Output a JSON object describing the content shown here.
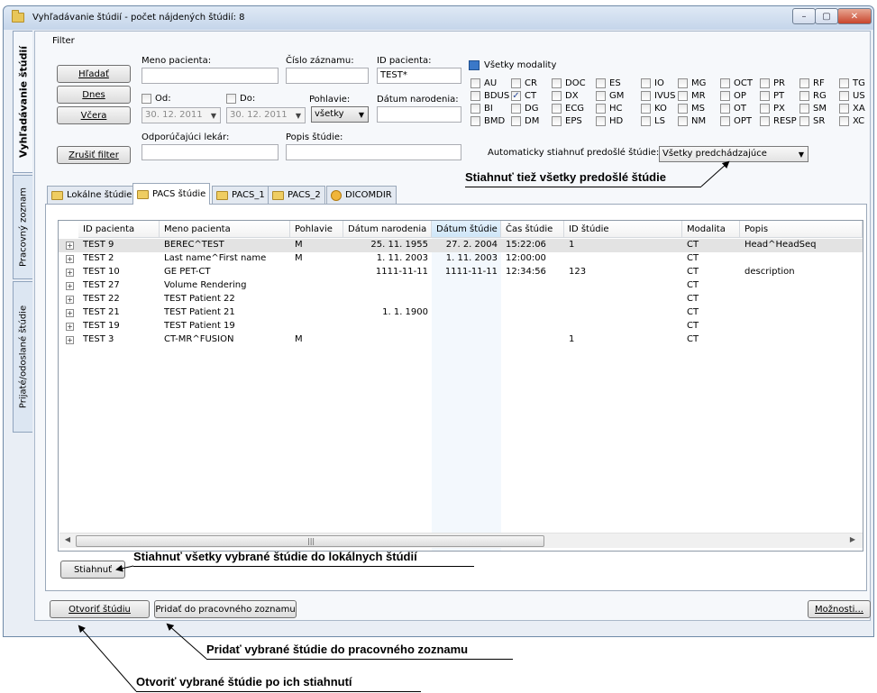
{
  "window": {
    "title": "Vyhľadávanie štúdií - počet nájdených štúdií: 8",
    "minimize": "–",
    "maximize": "▢",
    "close": "✕"
  },
  "side_tabs": [
    "Vyhľadávanie štúdií",
    "Pracovný zoznam",
    "Prijaté/odoslané štúdie"
  ],
  "filter": {
    "group_label": "Filter",
    "btn_search": "Hľadať",
    "btn_today": "Dnes",
    "btn_yesterday": "Včera",
    "btn_clear": "Zrušiť filter",
    "patient_name_label": "Meno pacienta:",
    "patient_name_value": "",
    "record_no_label": "Číslo záznamu:",
    "record_no_value": "",
    "patient_id_label": "ID pacienta:",
    "patient_id_value": "TEST*",
    "from_label": "Od:",
    "from_value": "30. 12. 2011",
    "to_label": "Do:",
    "to_value": "30. 12. 2011",
    "sex_label": "Pohlavie:",
    "sex_value": "všetky",
    "dob_label": "Dátum narodenia:",
    "dob_value": "",
    "referring_label": "Odporúčajúci lekár:",
    "referring_value": "",
    "study_desc_label": "Popis štúdie:",
    "study_desc_value": "",
    "all_modalities_label": "Všetky modality",
    "modalities": [
      [
        "AU",
        "CR",
        "DOC",
        "ES",
        "IO",
        "MG",
        "OCT",
        "PR",
        "RF",
        "TG"
      ],
      [
        "BDUS",
        "CT",
        "DX",
        "GM",
        "IVUS",
        "MR",
        "OP",
        "PT",
        "RG",
        "US"
      ],
      [
        "BI",
        "DG",
        "ECG",
        "HC",
        "KO",
        "MS",
        "OT",
        "PX",
        "SM",
        "XA"
      ],
      [
        "BMD",
        "DM",
        "EPS",
        "HD",
        "LS",
        "NM",
        "OPT",
        "RESP",
        "SR",
        "XC"
      ]
    ],
    "checked_modality": "CT",
    "auto_download_label": "Automaticky stiahnuť predošlé štúdie:",
    "auto_download_value": "Všetky predchádzajúce"
  },
  "tabs": [
    "Lokálne štúdie",
    "PACS štúdie",
    "PACS_1",
    "PACS_2",
    "DICOMDIR"
  ],
  "active_tab": "PACS štúdie",
  "grid": {
    "columns": [
      "ID pacienta",
      "Meno pacienta",
      "Pohlavie",
      "Dátum narodenia",
      "Dátum štúdie",
      "Čas štúdie",
      "ID štúdie",
      "Modalita",
      "Popis"
    ],
    "rows": [
      [
        "TEST 9",
        "BEREC^TEST",
        "M",
        "25. 11. 1955",
        "27. 2. 2004",
        "15:22:06",
        "1",
        "CT",
        "Head^HeadSeq"
      ],
      [
        "TEST 2",
        "Last name^First name",
        "M",
        "1. 11. 2003",
        "1. 11. 2003",
        "12:00:00",
        "",
        "CT",
        ""
      ],
      [
        "TEST 10",
        "GE PET-CT",
        "",
        "1111-11-11",
        "1111-11-11",
        "12:34:56",
        "123",
        "CT",
        "description"
      ],
      [
        "TEST 27",
        "Volume Rendering",
        "",
        "",
        "",
        "",
        "",
        "CT",
        ""
      ],
      [
        "TEST 22",
        "TEST Patient 22",
        "",
        "",
        "",
        "",
        "",
        "CT",
        ""
      ],
      [
        "TEST 21",
        "TEST Patient 21",
        "",
        "1. 1. 1900",
        "",
        "",
        "",
        "CT",
        ""
      ],
      [
        "TEST 19",
        "TEST Patient 19",
        "",
        "",
        "",
        "",
        "",
        "CT",
        ""
      ],
      [
        "TEST 3",
        "CT-MR^FUSION",
        "M",
        "",
        "",
        "",
        "1",
        "CT",
        ""
      ]
    ],
    "selected_row": 0
  },
  "buttons": {
    "download": "Stiahnuť",
    "open_study": "Otvoriť štúdiu",
    "add_worklist": "Pridať do pracovného zoznamu",
    "options": "Možnosti..."
  },
  "callouts": {
    "download_previous": "Stiahnuť tiež všetky predošlé štúdie",
    "download_selected": "Stiahnuť všetky vybrané štúdie do lokálnych štúdií",
    "add_selected": "Pridať vybrané štúdie do pracovného zoznamu",
    "open_selected": "Otvoriť vybrané štúdie po ich stiahnutí"
  }
}
